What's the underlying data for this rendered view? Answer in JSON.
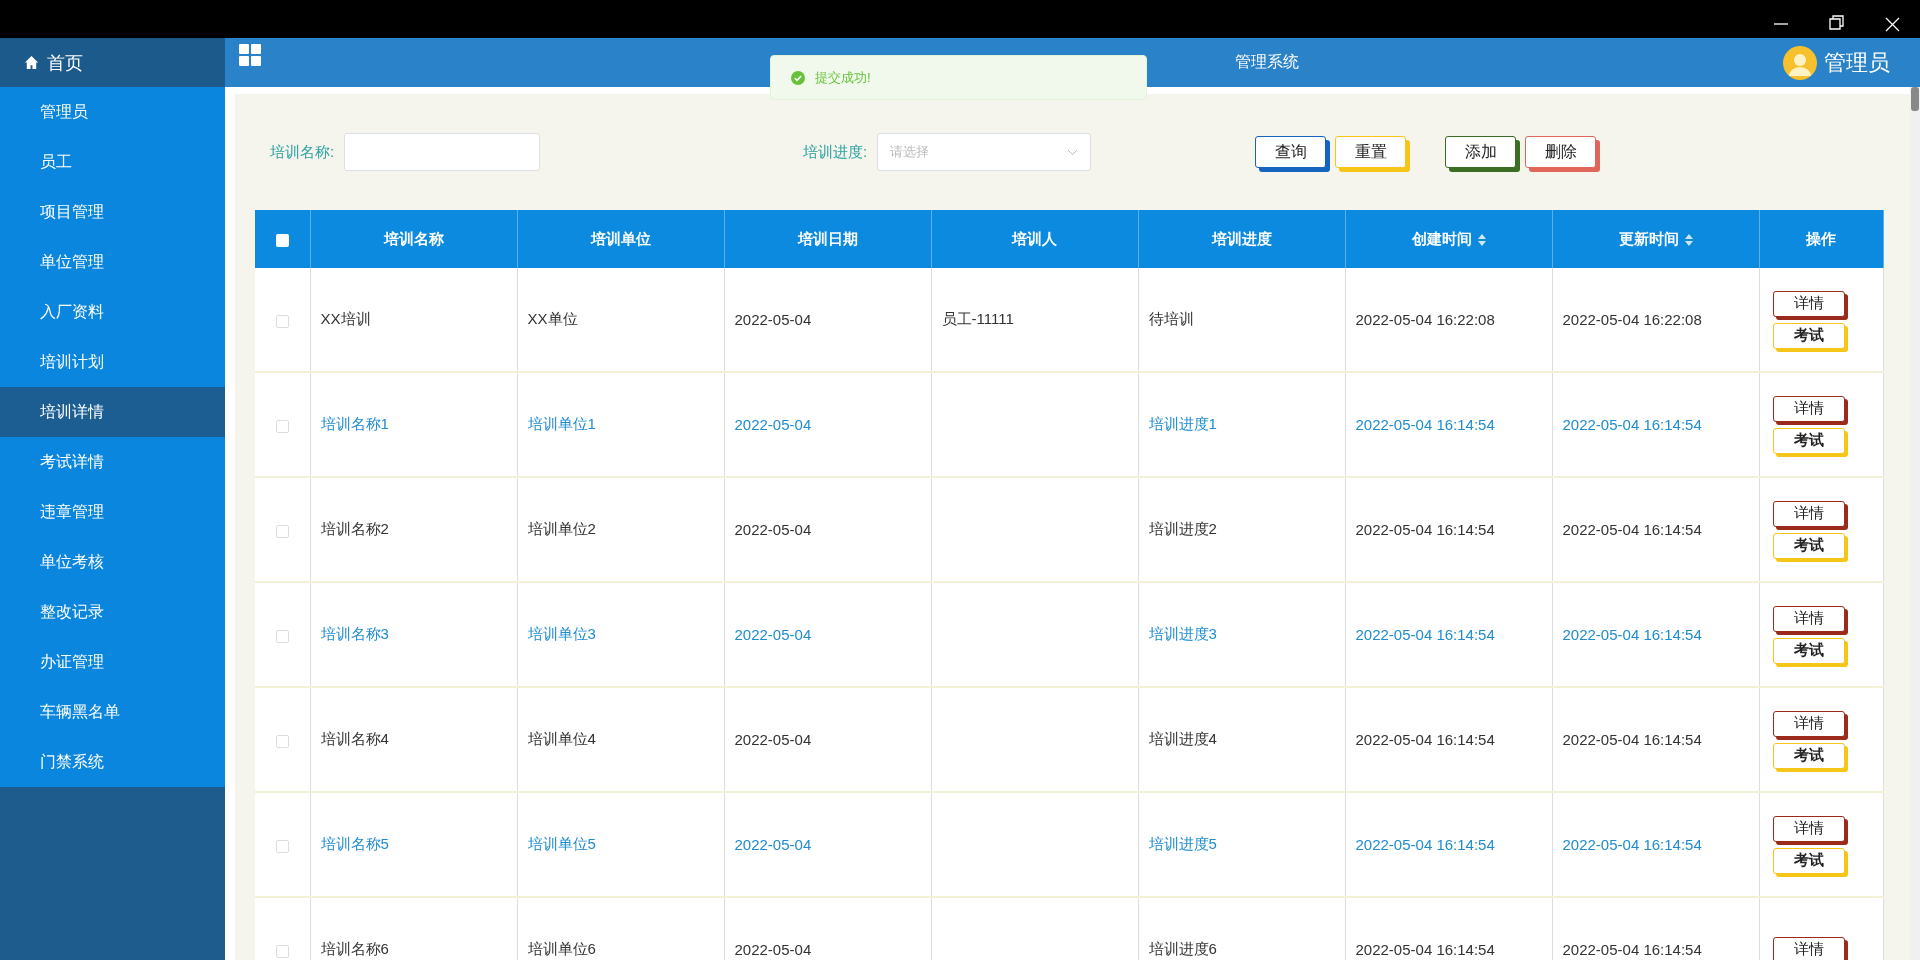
{
  "sidebar": {
    "home": "首页",
    "items": [
      {
        "label": "管理员",
        "selected": false
      },
      {
        "label": "员工",
        "selected": false
      },
      {
        "label": "项目管理",
        "selected": false
      },
      {
        "label": "单位管理",
        "selected": false
      },
      {
        "label": "入厂资料",
        "selected": false
      },
      {
        "label": "培训计划",
        "selected": false
      },
      {
        "label": "培训详情",
        "selected": true
      },
      {
        "label": "考试详情",
        "selected": false
      },
      {
        "label": "违章管理",
        "selected": false
      },
      {
        "label": "单位考核",
        "selected": false
      },
      {
        "label": "整改记录",
        "selected": false
      },
      {
        "label": "办证管理",
        "selected": false
      },
      {
        "label": "车辆黑名单",
        "selected": false
      },
      {
        "label": "门禁系统",
        "selected": false
      }
    ]
  },
  "topbar": {
    "title": "管理系统",
    "user": "管理员"
  },
  "toast": {
    "message": "提交成功!"
  },
  "search": {
    "fields": [
      {
        "kind": "text",
        "label": "培训名称:"
      },
      {
        "kind": "select",
        "label": "培训进度:",
        "placeholder": "请选择"
      }
    ],
    "buttons": [
      {
        "label": "查询",
        "color": "#1565c0"
      },
      {
        "label": "重置",
        "color": "#f5c518"
      },
      {
        "label": "添加",
        "color": "#3b6e22"
      },
      {
        "label": "删除",
        "color": "#e0665a"
      }
    ]
  },
  "table": {
    "columns": [
      {
        "label": "培训名称",
        "sortable": false
      },
      {
        "label": "培训单位",
        "sortable": false
      },
      {
        "label": "培训日期",
        "sortable": false
      },
      {
        "label": "培训人",
        "sortable": false
      },
      {
        "label": "培训进度",
        "sortable": false
      },
      {
        "label": "创建时间",
        "sortable": true
      },
      {
        "label": "更新时间",
        "sortable": true
      },
      {
        "label": "操作",
        "sortable": false
      }
    ],
    "rows": [
      {
        "checked": false,
        "cells": [
          "XX培训",
          "XX单位",
          "2022-05-04",
          "员工-11111",
          "待培训",
          "2022-05-04 16:22:08",
          "2022-05-04 16:22:08"
        ],
        "actions": [
          "详情",
          "考试"
        ]
      },
      {
        "checked": false,
        "cells": [
          "培训名称1",
          "培训单位1",
          "2022-05-04",
          null,
          "培训进度1",
          "2022-05-04 16:14:54",
          "2022-05-04 16:14:54"
        ],
        "actions": [
          "详情",
          "考试"
        ]
      },
      {
        "checked": false,
        "cells": [
          "培训名称2",
          "培训单位2",
          "2022-05-04",
          null,
          "培训进度2",
          "2022-05-04 16:14:54",
          "2022-05-04 16:14:54"
        ],
        "actions": [
          "详情",
          "考试"
        ]
      },
      {
        "checked": false,
        "cells": [
          "培训名称3",
          "培训单位3",
          "2022-05-04",
          null,
          "培训进度3",
          "2022-05-04 16:14:54",
          "2022-05-04 16:14:54"
        ],
        "actions": [
          "详情",
          "考试"
        ]
      },
      {
        "checked": false,
        "cells": [
          "培训名称4",
          "培训单位4",
          "2022-05-04",
          null,
          "培训进度4",
          "2022-05-04 16:14:54",
          "2022-05-04 16:14:54"
        ],
        "actions": [
          "详情",
          "考试"
        ]
      },
      {
        "checked": false,
        "cells": [
          "培训名称5",
          "培训单位5",
          "2022-05-04",
          null,
          "培训进度5",
          "2022-05-04 16:14:54",
          "2022-05-04 16:14:54"
        ],
        "actions": [
          "详情",
          "考试"
        ]
      },
      {
        "checked": false,
        "cells": [
          "培训名称6",
          "培训单位6",
          "2022-05-04",
          null,
          "培训进度6",
          "2022-05-04 16:14:54",
          "2022-05-04 16:14:54"
        ],
        "actions": [
          "详情"
        ]
      }
    ],
    "all_checked": false
  }
}
